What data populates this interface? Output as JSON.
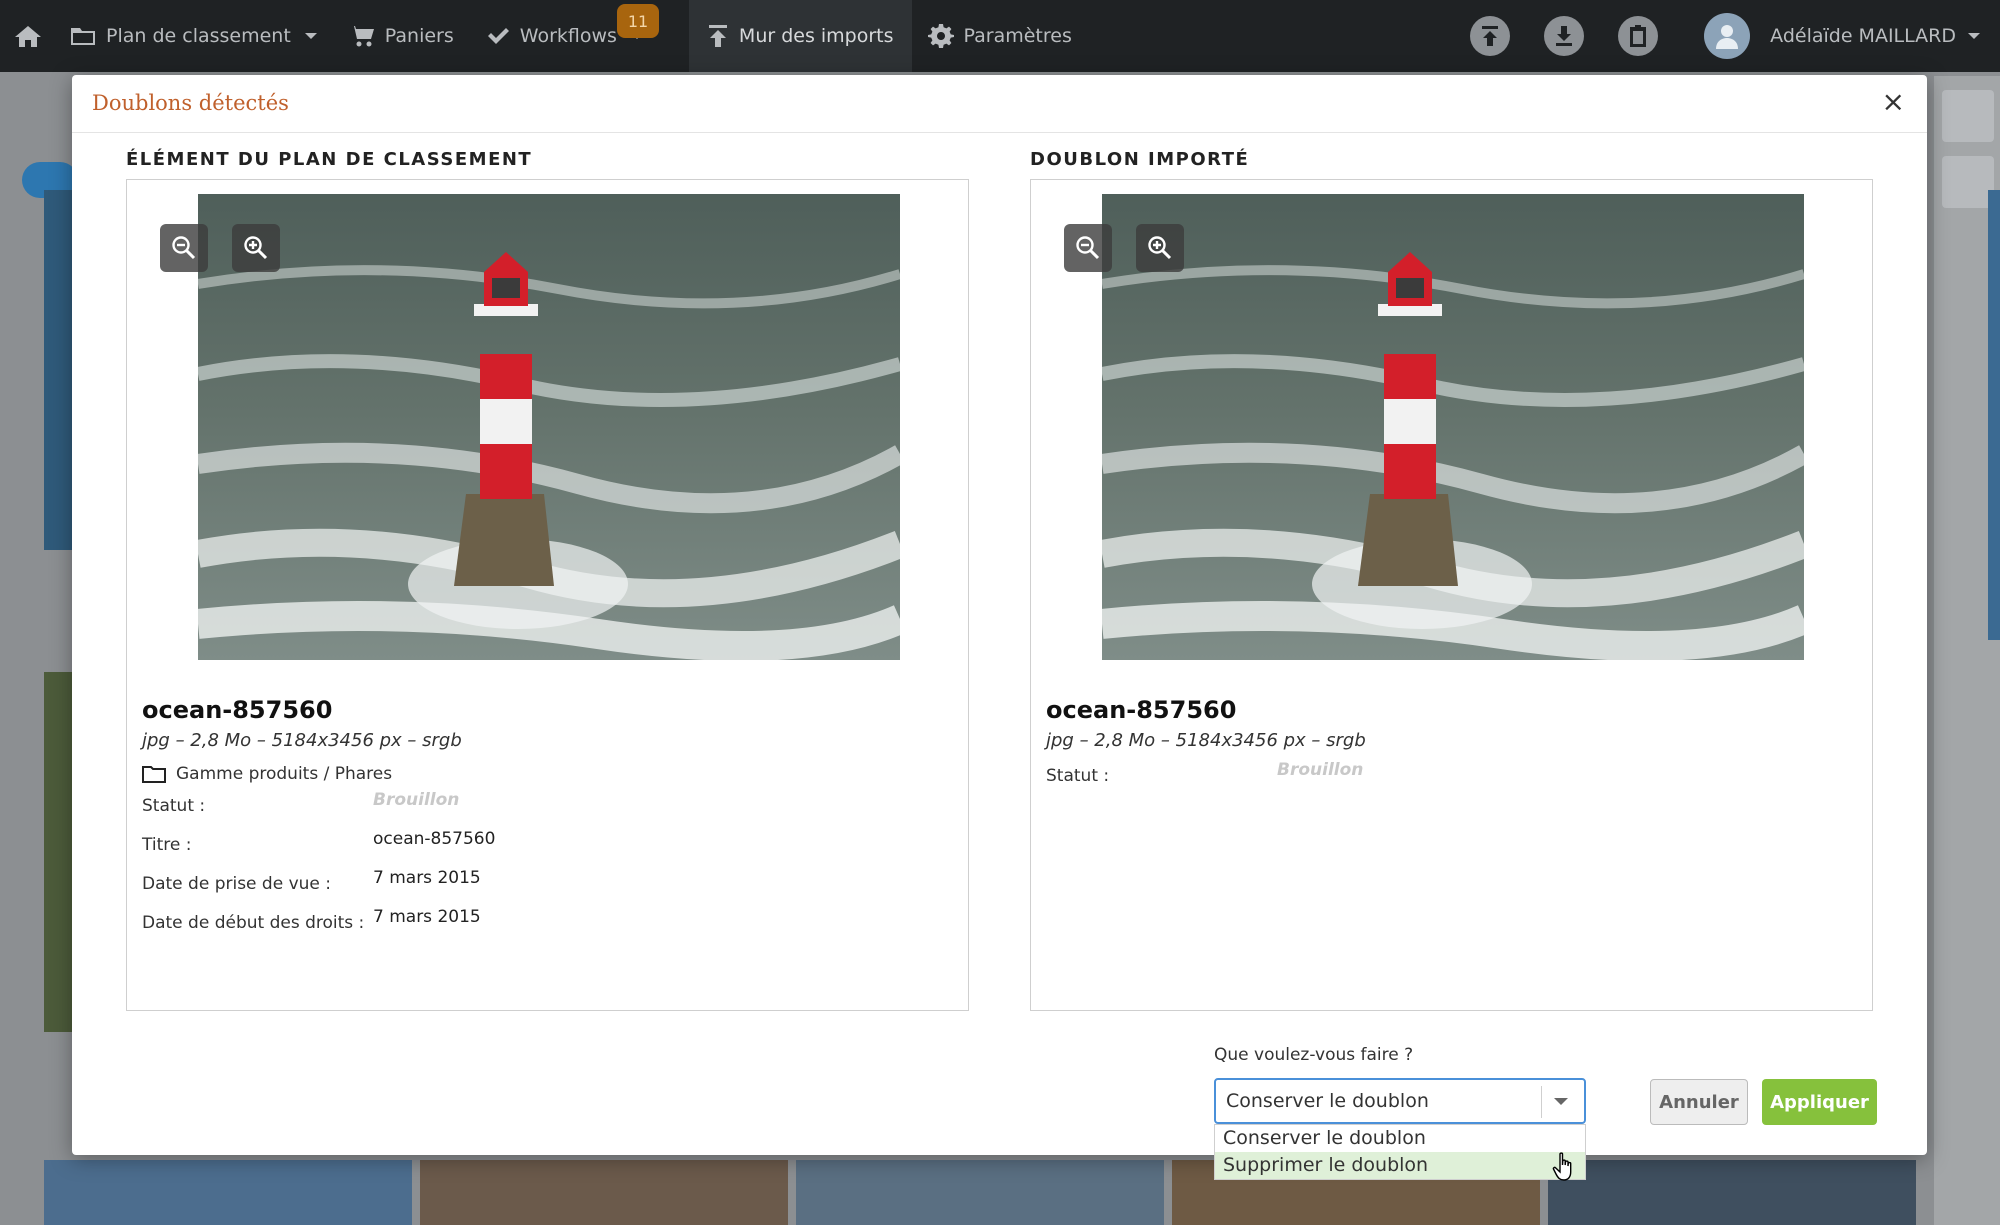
{
  "nav": {
    "items": [
      {
        "label": "Plan de classement",
        "icon": "folder-icon",
        "dropdown": true
      },
      {
        "label": "Paniers",
        "icon": "cart-icon",
        "dropdown": false
      },
      {
        "label": "Workflows",
        "icon": "check-icon",
        "dropdown": true,
        "badge": "11"
      },
      {
        "label": "Mur des imports",
        "icon": "upload-icon",
        "dropdown": false,
        "active": true
      },
      {
        "label": "Paramètres",
        "icon": "gear-icon",
        "dropdown": false
      }
    ],
    "user_name": "Adélaïde MAILLARD"
  },
  "modal": {
    "title": "Doublons détectés",
    "close_label": "×",
    "left": {
      "heading": "ÉLÉMENT DU PLAN DE CLASSEMENT",
      "name": "ocean-857560",
      "meta": "jpg – 2,8 Mo – 5184x3456 px – srgb",
      "path": "Gamme produits / Phares",
      "fields": [
        {
          "label": "Statut :",
          "value": "Brouillon"
        },
        {
          "label": "Titre :",
          "value": "ocean-857560"
        },
        {
          "label": "Date de prise de vue :",
          "value": "7 mars 2015"
        },
        {
          "label": "Date de début des droits :",
          "value": "7 mars 2015"
        }
      ]
    },
    "right": {
      "heading": "DOUBLON IMPORTÉ",
      "name": "ocean-857560",
      "meta": "jpg – 2,8 Mo – 5184x3456 px – srgb",
      "fields": [
        {
          "label": "Statut :",
          "value": "Brouillon"
        }
      ]
    },
    "action": {
      "question": "Que voulez-vous faire ?",
      "selected": "Conserver le doublon",
      "options": [
        "Conserver le doublon",
        "Supprimer le doublon"
      ]
    },
    "buttons": {
      "cancel": "Annuler",
      "apply": "Appliquer"
    }
  },
  "colors": {
    "nav_bg": "#1f2224",
    "title": "#c0602c",
    "apply": "#86c13c",
    "badge": "#a8650e",
    "select_border": "#4a90d9"
  }
}
